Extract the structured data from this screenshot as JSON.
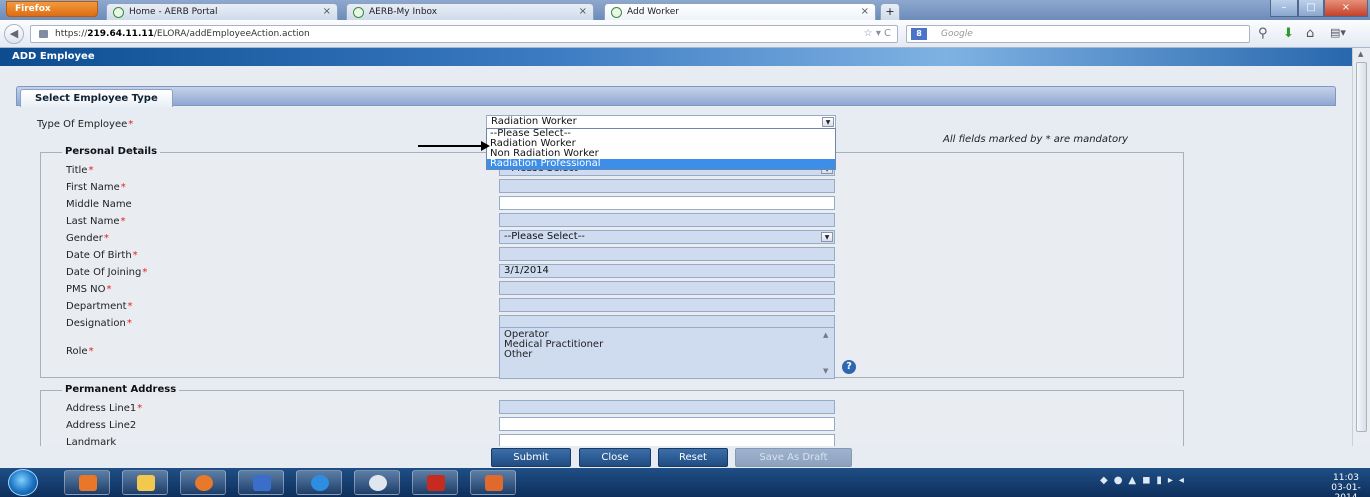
{
  "browser": {
    "menu_button": "Firefox",
    "tabs": [
      {
        "label": "Home - AERB Portal"
      },
      {
        "label": "AERB-My Inbox"
      },
      {
        "label": "Add Worker"
      }
    ],
    "url_prefix": "https://",
    "url_host": "219.64.11.11",
    "url_path": "/ELORA/addEmployeeAction.action",
    "search_placeholder": "Google",
    "search_engine_icon": "g-icon"
  },
  "page": {
    "title": "ADD Employee",
    "section_tab": "Select Employee Type",
    "mandatory_note": "All fields marked by * are mandatory",
    "employee_type": {
      "label": "Type Of Employee",
      "value": "Radiation Worker",
      "options": [
        "--Please Select--",
        "Radiation Worker",
        "Non Radiation Worker",
        "Radiation Professional"
      ],
      "highlighted": "Radiation Professional"
    },
    "personal_details": {
      "legend": "Personal Details",
      "title_label": "Title",
      "title_value": "--Please Select--",
      "first_name_label": "First Name",
      "middle_name_label": "Middle Name",
      "last_name_label": "Last Name",
      "gender_label": "Gender",
      "gender_value": "--Please Select--",
      "dob_label": "Date Of Birth",
      "doj_label": "Date Of Joining",
      "doj_value": "3/1/2014",
      "pms_label": "PMS NO",
      "department_label": "Department",
      "designation_label": "Designation",
      "role_label": "Role",
      "role_options": [
        "Operator",
        "Medical Practitioner",
        "Other"
      ]
    },
    "permanent_address": {
      "legend": "Permanent Address",
      "line1_label": "Address Line1",
      "line2_label": "Address Line2",
      "landmark_label": "Landmark"
    }
  },
  "buttons": {
    "submit": "Submit",
    "close": "Close",
    "reset": "Reset",
    "save_draft": "Save As Draft"
  },
  "taskbar": {
    "time": "11:03",
    "date": "03-01-2014"
  }
}
